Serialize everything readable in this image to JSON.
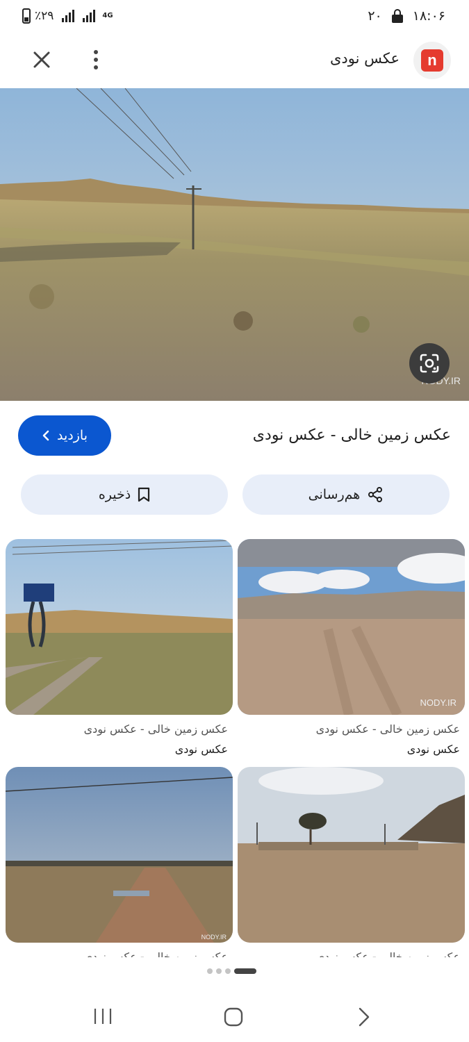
{
  "status_bar": {
    "time": "۱۸:۰۶",
    "notification_count": "۲۰",
    "battery": "٪۲۹",
    "network": "4G"
  },
  "header": {
    "site_name": "عکس نودی",
    "logo_letter": "n"
  },
  "main_image": {
    "watermark": "NODY.IR"
  },
  "result": {
    "title": "عکس زمین خالی - عکس نودی",
    "visit_label": "بازدید"
  },
  "actions": {
    "share_label": "هم‌رسانی",
    "save_label": "ذخیره"
  },
  "related": [
    {
      "caption": "عکس زمین خالی - عکس نودی",
      "source": "عکس نودی",
      "watermark": "NODY.IR"
    },
    {
      "caption": "عکس زمین خالی - عکس نودی",
      "source": "عکس نودی",
      "watermark": ""
    },
    {
      "caption": "عکس زمین خالی - عکس نودی",
      "source": "",
      "watermark": ""
    },
    {
      "caption": "عکس زمین خالی - عکس نودی",
      "source": "",
      "watermark": "NODY.IR"
    }
  ],
  "pager": {
    "total": 4,
    "active": 3
  },
  "colors": {
    "accent": "#0b57d0",
    "action_bg": "#e8eef9",
    "logo_red": "#e53b2f"
  }
}
